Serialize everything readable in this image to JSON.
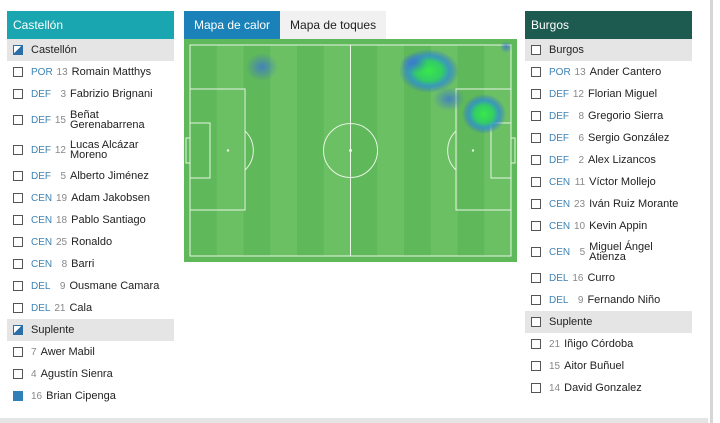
{
  "tabs": [
    {
      "label": "Mapa de calor",
      "active": true
    },
    {
      "label": "Mapa de toques",
      "active": false
    }
  ],
  "home": {
    "team": "Castellón",
    "color": "#1aa6b0",
    "rows": [
      {
        "kind": "group",
        "label": "Castellón",
        "check": "partial"
      },
      {
        "kind": "player",
        "pos": "POR",
        "num": "13",
        "name": "Romain Matthys"
      },
      {
        "kind": "player",
        "pos": "DEF",
        "num": "3",
        "name": "Fabrizio Brignani"
      },
      {
        "kind": "player",
        "pos": "DEF",
        "num": "15",
        "name": "Beñat Gerenabarrena",
        "tall": true
      },
      {
        "kind": "player",
        "pos": "DEF",
        "num": "12",
        "name": "Lucas Alcázar Moreno",
        "tall": true
      },
      {
        "kind": "player",
        "pos": "DEF",
        "num": "5",
        "name": "Alberto Jiménez"
      },
      {
        "kind": "player",
        "pos": "CEN",
        "num": "19",
        "name": "Adam Jakobsen"
      },
      {
        "kind": "player",
        "pos": "CEN",
        "num": "18",
        "name": "Pablo Santiago"
      },
      {
        "kind": "player",
        "pos": "CEN",
        "num": "25",
        "name": "Ronaldo"
      },
      {
        "kind": "player",
        "pos": "CEN",
        "num": "8",
        "name": "Barri"
      },
      {
        "kind": "player",
        "pos": "DEL",
        "num": "9",
        "name": "Ousmane Camara"
      },
      {
        "kind": "player",
        "pos": "DEL",
        "num": "21",
        "name": "Cala"
      },
      {
        "kind": "group",
        "label": "Suplente",
        "check": "partial"
      },
      {
        "kind": "sub",
        "num": "7",
        "name": "Awer Mabil"
      },
      {
        "kind": "sub",
        "num": "4",
        "name": "Agustín Sienra"
      },
      {
        "kind": "sub",
        "num": "16",
        "name": "Brian Cipenga",
        "check": "checked"
      }
    ]
  },
  "away": {
    "team": "Burgos",
    "color": "#1d5a50",
    "rows": [
      {
        "kind": "group",
        "label": "Burgos",
        "check": "empty"
      },
      {
        "kind": "player",
        "pos": "POR",
        "num": "13",
        "name": "Ander Cantero"
      },
      {
        "kind": "player",
        "pos": "DEF",
        "num": "12",
        "name": "Florian Miguel"
      },
      {
        "kind": "player",
        "pos": "DEF",
        "num": "8",
        "name": "Gregorio Sierra"
      },
      {
        "kind": "player",
        "pos": "DEF",
        "num": "6",
        "name": "Sergio González"
      },
      {
        "kind": "player",
        "pos": "DEF",
        "num": "2",
        "name": "Alex Lizancos"
      },
      {
        "kind": "player",
        "pos": "CEN",
        "num": "11",
        "name": "Víctor Mollejo"
      },
      {
        "kind": "player",
        "pos": "CEN",
        "num": "23",
        "name": "Iván Ruiz Morante"
      },
      {
        "kind": "player",
        "pos": "CEN",
        "num": "10",
        "name": "Kevin Appin"
      },
      {
        "kind": "player",
        "pos": "CEN",
        "num": "5",
        "name": "Miguel Ángel Atienza",
        "tall": true
      },
      {
        "kind": "player",
        "pos": "DEL",
        "num": "16",
        "name": "Curro"
      },
      {
        "kind": "player",
        "pos": "DEL",
        "num": "9",
        "name": "Fernando Niño"
      },
      {
        "kind": "group",
        "label": "Suplente",
        "check": "empty"
      },
      {
        "kind": "sub",
        "num": "21",
        "name": "Iñigo Córdoba"
      },
      {
        "kind": "sub",
        "num": "15",
        "name": "Aitor Buñuel"
      },
      {
        "kind": "sub",
        "num": "14",
        "name": "David Gonzalez"
      }
    ]
  },
  "heatmap": {
    "pitch_color": "#5fb85a",
    "stripe_color": "#6cc064",
    "line_color": "#e8f5e4"
  }
}
